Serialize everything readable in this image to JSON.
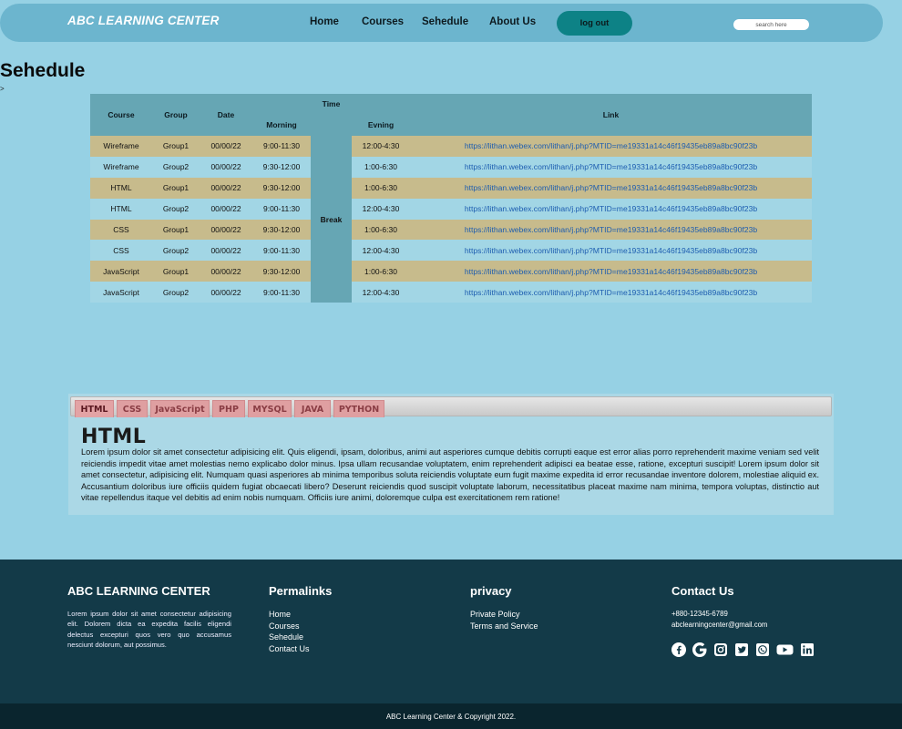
{
  "header": {
    "brand": "ABC LEARNING CENTER",
    "nav": [
      "Home",
      "Courses",
      "Sehedule",
      "About Us"
    ],
    "logout_label": "log out",
    "search_placeholder": "search here"
  },
  "page": {
    "title": "Sehedule",
    "crumb": ">"
  },
  "schedule": {
    "headers": {
      "course": "Course",
      "group": "Group",
      "date": "Date",
      "time": "Time",
      "morning": "Morning",
      "evening": "Evning",
      "link": "Link"
    },
    "break_label": "Break",
    "rows": [
      {
        "course": "Wireframe",
        "group": "Group1",
        "date": "00/00/22",
        "morning": "9:00-11:30",
        "evening": "12:00-4:30",
        "link": "https://lithan.webex.com/lithan/j.php?MTID=me19331a14c46f19435eb89a8bc90f23b"
      },
      {
        "course": "Wireframe",
        "group": "Group2",
        "date": "00/00/22",
        "morning": "9:30-12:00",
        "evening": "1:00-6:30",
        "link": "https://lithan.webex.com/lithan/j.php?MTID=me19331a14c46f19435eb89a8bc90f23b"
      },
      {
        "course": "HTML",
        "group": "Group1",
        "date": "00/00/22",
        "morning": "9:30-12:00",
        "evening": "1:00-6:30",
        "link": "https://lithan.webex.com/lithan/j.php?MTID=me19331a14c46f19435eb89a8bc90f23b"
      },
      {
        "course": "HTML",
        "group": "Group2",
        "date": "00/00/22",
        "morning": "9:00-11:30",
        "evening": "12:00-4:30",
        "link": "https://lithan.webex.com/lithan/j.php?MTID=me19331a14c46f19435eb89a8bc90f23b"
      },
      {
        "course": "CSS",
        "group": "Group1",
        "date": "00/00/22",
        "morning": "9:30-12:00",
        "evening": "1:00-6:30",
        "link": "https://lithan.webex.com/lithan/j.php?MTID=me19331a14c46f19435eb89a8bc90f23b"
      },
      {
        "course": "CSS",
        "group": "Group2",
        "date": "00/00/22",
        "morning": "9:00-11:30",
        "evening": "12:00-4:30",
        "link": "https://lithan.webex.com/lithan/j.php?MTID=me19331a14c46f19435eb89a8bc90f23b"
      },
      {
        "course": "JavaScript",
        "group": "Group1",
        "date": "00/00/22",
        "morning": "9:30-12:00",
        "evening": "1:00-6:30",
        "link": "https://lithan.webex.com/lithan/j.php?MTID=me19331a14c46f19435eb89a8bc90f23b"
      },
      {
        "course": "JavaScript",
        "group": "Group2",
        "date": "00/00/22",
        "morning": "9:00-11:30",
        "evening": "12:00-4:30",
        "link": "https://lithan.webex.com/lithan/j.php?MTID=me19331a14c46f19435eb89a8bc90f23b"
      }
    ]
  },
  "tabs": {
    "items": [
      "HTML",
      "CSS",
      "JavaScript",
      "PHP",
      "MYSQL",
      "JAVA",
      "PYTHON"
    ],
    "active": "HTML",
    "content_title": "HTML",
    "content_body": "Lorem ipsum dolor sit amet consectetur adipisicing elit. Quis eligendi, ipsam, doloribus, animi aut asperiores cumque debitis corrupti eaque est error alias porro reprehenderit maxime veniam sed velit reiciendis impedit vitae amet molestias nemo explicabo dolor minus. Ipsa ullam recusandae voluptatem, enim reprehenderit adipisci ea beatae esse, ratione, excepturi suscipit! Lorem ipsum dolor sit amet consectetur, adipisicing elit. Numquam quasi asperiores ab minima temporibus soluta reiciendis voluptate eum fugit maxime expedita id error recusandae inventore dolorem, molestiae aliquid ex. Accusantium doloribus iure officiis quidem fugiat obcaecati libero? Deserunt reiciendis quod suscipit voluptate laborum, necessitatibus placeat maxime nam minima, tempora voluptas, distinctio aut vitae repellendus itaque vel debitis ad enim nobis numquam. Officiis iure animi, doloremque culpa est exercitationem rem ratione!"
  },
  "footer": {
    "about": {
      "title": "ABC LEARNING CENTER",
      "text": "Lorem ipsum dolor sit amet consectetur adipisicing elit. Dolorem dicta ea expedita facilis eligendi delectus excepturi quos vero quo accusamus nesciunt dolorum, aut possimus."
    },
    "permalinks": {
      "title": "Permalinks",
      "links": [
        "Home",
        "Courses",
        "Sehedule",
        "Contact Us"
      ]
    },
    "privacy": {
      "title": "privacy",
      "links": [
        "Private Policy",
        "Terms and Service"
      ]
    },
    "contact": {
      "title": "Contact Us",
      "phone": "+880-12345-6789",
      "email": "abclearningcenter@gmail.com",
      "social_icons": [
        "facebook-icon",
        "google-icon",
        "instagram-icon",
        "twitter-icon",
        "whatsapp-icon",
        "youtube-icon",
        "linkedin-icon"
      ]
    },
    "copyright": "ABC Learning Center & Copyright 2022."
  },
  "colors": {
    "page_bg": "#96d1e4",
    "nav_bg": "#6cb5ce",
    "logout_bg": "#0d8286",
    "table_header": "#66a6b4",
    "row_odd": "#c7bb8c",
    "row_even": "#a2d6e5",
    "tab_bg": "#df9fa1",
    "footer_bg": "#133a48",
    "copyright_bg": "#0a252e",
    "link": "#1d5db0"
  }
}
